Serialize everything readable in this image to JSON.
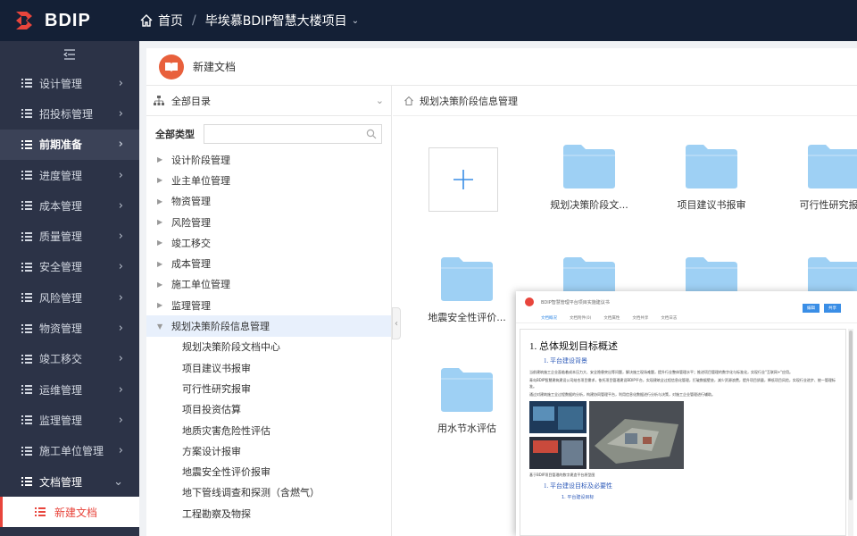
{
  "app": {
    "brand": "BDIP",
    "brand_color": "#e8453c"
  },
  "breadcrumb": {
    "home": "首页",
    "separator": "/",
    "project": "毕埃慕BDIP智慧大楼项目"
  },
  "sidebar": {
    "items": [
      {
        "label": "设计管理",
        "icon": "list-icon",
        "arrow": "›"
      },
      {
        "label": "招投标管理",
        "icon": "list-icon",
        "arrow": "›"
      },
      {
        "label": "前期准备",
        "icon": "list-icon",
        "arrow": "›",
        "active": true
      },
      {
        "label": "进度管理",
        "icon": "list-icon",
        "arrow": "›"
      },
      {
        "label": "成本管理",
        "icon": "list-icon",
        "arrow": "›"
      },
      {
        "label": "质量管理",
        "icon": "list-icon",
        "arrow": "›"
      },
      {
        "label": "安全管理",
        "icon": "list-icon",
        "arrow": "›"
      },
      {
        "label": "风险管理",
        "icon": "list-icon",
        "arrow": "›"
      },
      {
        "label": "物资管理",
        "icon": "list-icon",
        "arrow": "›"
      },
      {
        "label": "竣工移交",
        "icon": "list-icon",
        "arrow": "›"
      },
      {
        "label": "运维管理",
        "icon": "list-icon",
        "arrow": "›"
      },
      {
        "label": "监理管理",
        "icon": "list-icon",
        "arrow": "›"
      },
      {
        "label": "施工单位管理",
        "icon": "list-icon",
        "arrow": "›"
      },
      {
        "label": "文档管理",
        "icon": "list-icon",
        "arrow": "⌄",
        "open": true
      }
    ],
    "sub_active": "新建文档"
  },
  "page": {
    "title": "新建文档"
  },
  "tree": {
    "root_label": "全部目录",
    "filter_label": "全部类型",
    "filter_value": "",
    "nodes": [
      "设计阶段管理",
      "业主单位管理",
      "物资管理",
      "风险管理",
      "竣工移交",
      "成本管理",
      "施工单位管理",
      "监理管理"
    ],
    "expanded_node": "规划决策阶段信息管理",
    "leaves": [
      "规划决策阶段文档中心",
      "项目建议书报审",
      "可行性研究报审",
      "项目投资估算",
      "地质灾害危险性评估",
      "方案设计报审",
      "地震安全性评价报审",
      "地下管线调查和探测（含燃气）",
      "工程勘察及物探"
    ]
  },
  "files": {
    "path": "规划决策阶段信息管理",
    "folder_color": "#9ed0f4",
    "tiles": [
      {
        "name": "规划决策阶段文..."
      },
      {
        "name": "项目建议书报审"
      },
      {
        "name": "可行性研究报审"
      },
      {
        "name": "地震安全性评价..."
      },
      {
        "name": ""
      },
      {
        "name": ""
      },
      {
        "name": ""
      },
      {
        "name": "用水节水评估"
      }
    ]
  },
  "preview": {
    "title": "BDIP智慧管理平台项目实施建议书",
    "tabs": [
      "文档概况",
      "文档附件(0)",
      "文档属性",
      "文档共享",
      "文档日志"
    ],
    "buttons": [
      "编辑",
      "共享"
    ],
    "h1": "1. 总体规划目标概述",
    "h2_a": "1. 平台建设背景",
    "p1": "当前建筑施工企业面临着成本压力大、安全隐患突出等问题，解决施工现场难题，提升行业整体管理水平；推进项目管理的数字化与标准化，实现行业\"互联网+\"应用。",
    "p2": "青岛BDIP智慧建筑建设公司结合项目需求，依托项目管理建设BDIP平台，实现建筑全过程信息化管理，打破数据壁垒，减少资源浪费，提升项目质量，降低项目风险，实现行业进步、统一管理标准。",
    "p3": "通过对建筑施工全过程数据的分析，构建协同管理平台，利用信息化数据进行分析与决策，对施工企业管理进行辅助。",
    "caption": "基于BDIP项目管理的数字建造平台原型图",
    "h2_b": "1. 平台建设目标及必要性",
    "h3": "1. 平台建设目标"
  }
}
